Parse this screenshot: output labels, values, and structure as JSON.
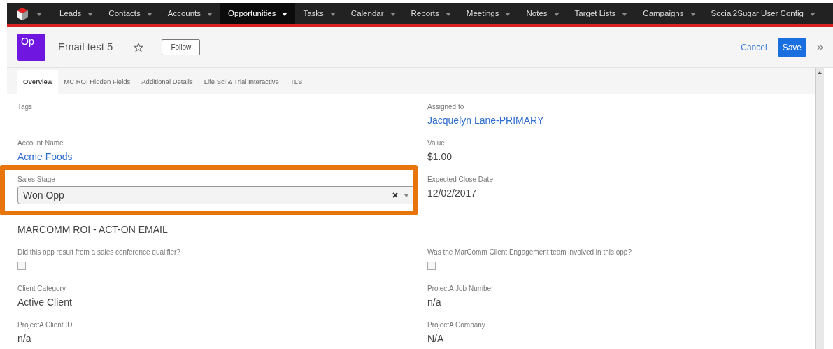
{
  "nav": {
    "items": [
      {
        "label": "Leads",
        "selected": false
      },
      {
        "label": "Contacts",
        "selected": false
      },
      {
        "label": "Accounts",
        "selected": false
      },
      {
        "label": "Opportunities",
        "selected": true
      },
      {
        "label": "Tasks",
        "selected": false
      },
      {
        "label": "Calendar",
        "selected": false
      },
      {
        "label": "Reports",
        "selected": false
      },
      {
        "label": "Meetings",
        "selected": false
      },
      {
        "label": "Notes",
        "selected": false
      },
      {
        "label": "Target Lists",
        "selected": false
      },
      {
        "label": "Campaigns",
        "selected": false
      },
      {
        "label": "Social2Sugar User Config",
        "selected": false
      }
    ]
  },
  "header": {
    "badge": "Op",
    "title": "Email test 5",
    "follow": "Follow",
    "cancel": "Cancel",
    "save": "Save"
  },
  "tabs": [
    {
      "label": "Overview",
      "selected": true
    },
    {
      "label": "MC ROI Hidden Fields",
      "selected": false
    },
    {
      "label": "Additional Details",
      "selected": false
    },
    {
      "label": "Life Sci & Trial Interactive",
      "selected": false
    },
    {
      "label": "TLS",
      "selected": false
    }
  ],
  "rows": [
    {
      "cells": [
        {
          "kind": "text",
          "label": "Tags"
        },
        {
          "kind": "link",
          "label": "Assigned to",
          "value": "Jacquelyn Lane-PRIMARY"
        }
      ]
    },
    {
      "cells": [
        {
          "kind": "link",
          "label": "Account Name",
          "value": "Acme Foods"
        },
        {
          "kind": "text",
          "label": "Value",
          "value": "$1.00"
        }
      ]
    },
    {
      "highlighted": true,
      "cells": [
        {
          "kind": "select",
          "label": "Sales Stage",
          "value": "Won Opp"
        },
        {
          "kind": "text",
          "label": "Expected Close Date",
          "value": "12/02/2017"
        }
      ]
    },
    {
      "cells": [
        {
          "kind": "text",
          "value": "MARCOMM ROI - ACT-ON EMAIL"
        }
      ]
    },
    {
      "cells": [
        {
          "kind": "checkbox",
          "label": "Did this opp result from a sales conference qualifier?",
          "checked": false
        },
        {
          "kind": "checkbox",
          "label": "Was the MarComm Client Engagement team involved in this opp?",
          "checked": false
        }
      ]
    },
    {
      "cells": [
        {
          "kind": "text",
          "label": "Client Category",
          "value": "Active Client"
        },
        {
          "kind": "text",
          "label": "ProjectA Job Number",
          "value": "n/a"
        }
      ]
    },
    {
      "cells": [
        {
          "kind": "text",
          "label": "ProjectA Client ID",
          "value": "n/a"
        },
        {
          "kind": "text",
          "label": "ProjectA Company",
          "value": "N/A"
        }
      ]
    }
  ]
}
